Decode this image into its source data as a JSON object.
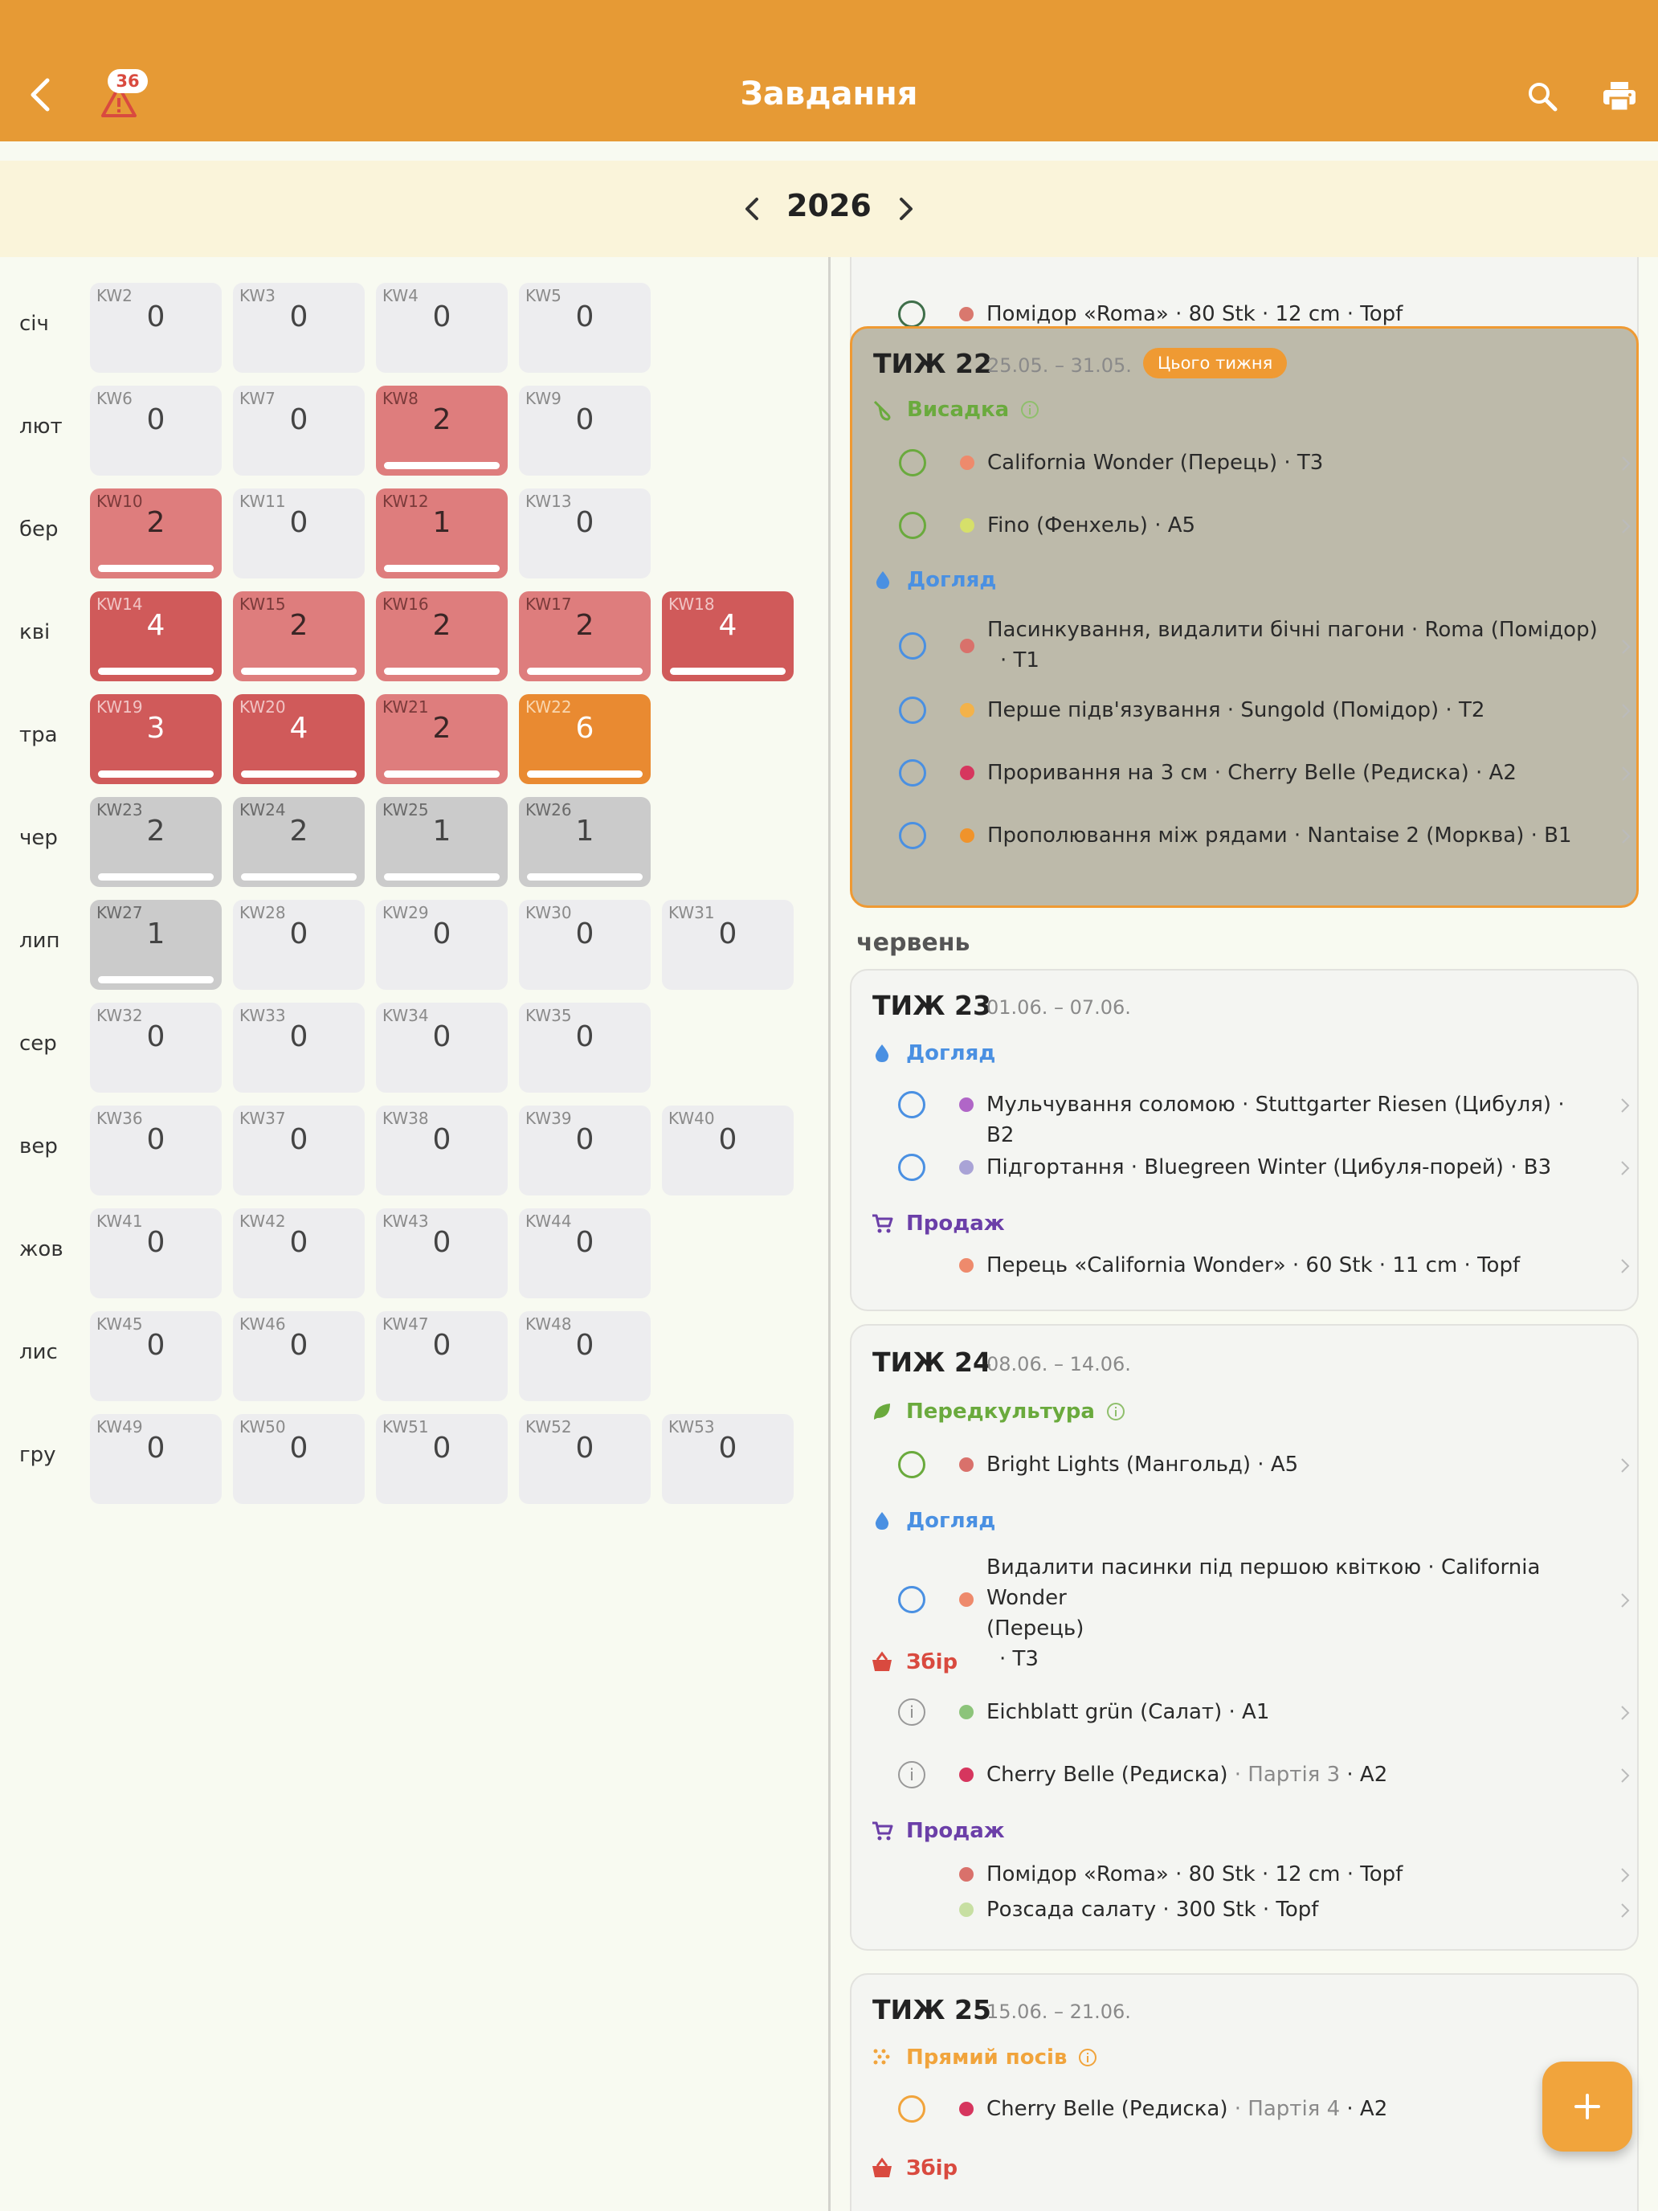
{
  "app": {
    "title": "Завдання",
    "alert_count": "36",
    "year": "2026"
  },
  "colors": {
    "accent": "#e69a35",
    "current_week": "#e98a31",
    "low": "#de7d7d",
    "high": "#d05a5a",
    "past": "#cbcbcb",
    "empty": "#ededef"
  },
  "icons": [
    "back-icon",
    "warning-icon",
    "search-icon",
    "print-icon",
    "chevron-left-icon",
    "chevron-right-icon",
    "plus-icon"
  ],
  "grid": {
    "months": [
      {
        "label": "січ",
        "weeks": [
          {
            "kw": "KW2",
            "count": "0",
            "level": "empty"
          },
          {
            "kw": "KW3",
            "count": "0",
            "level": "empty"
          },
          {
            "kw": "KW4",
            "count": "0",
            "level": "empty"
          },
          {
            "kw": "KW5",
            "count": "0",
            "level": "empty"
          }
        ]
      },
      {
        "label": "лют",
        "weeks": [
          {
            "kw": "KW6",
            "count": "0",
            "level": "empty"
          },
          {
            "kw": "KW7",
            "count": "0",
            "level": "empty"
          },
          {
            "kw": "KW8",
            "count": "2",
            "level": "r1"
          },
          {
            "kw": "KW9",
            "count": "0",
            "level": "empty"
          }
        ]
      },
      {
        "label": "бер",
        "weeks": [
          {
            "kw": "KW10",
            "count": "2",
            "level": "r1"
          },
          {
            "kw": "KW11",
            "count": "0",
            "level": "empty"
          },
          {
            "kw": "KW12",
            "count": "1",
            "level": "r1"
          },
          {
            "kw": "KW13",
            "count": "0",
            "level": "empty"
          }
        ]
      },
      {
        "label": "кві",
        "weeks": [
          {
            "kw": "KW14",
            "count": "4",
            "level": "r2"
          },
          {
            "kw": "KW15",
            "count": "2",
            "level": "r1"
          },
          {
            "kw": "KW16",
            "count": "2",
            "level": "r1"
          },
          {
            "kw": "KW17",
            "count": "2",
            "level": "r1"
          },
          {
            "kw": "KW18",
            "count": "4",
            "level": "r2"
          }
        ]
      },
      {
        "label": "тра",
        "weeks": [
          {
            "kw": "KW19",
            "count": "3",
            "level": "r2"
          },
          {
            "kw": "KW20",
            "count": "4",
            "level": "r2"
          },
          {
            "kw": "KW21",
            "count": "2",
            "level": "r1"
          },
          {
            "kw": "KW22",
            "count": "6",
            "level": "cur"
          }
        ]
      },
      {
        "label": "чер",
        "weeks": [
          {
            "kw": "KW23",
            "count": "2",
            "level": "gray"
          },
          {
            "kw": "KW24",
            "count": "2",
            "level": "gray"
          },
          {
            "kw": "KW25",
            "count": "1",
            "level": "gray"
          },
          {
            "kw": "KW26",
            "count": "1",
            "level": "gray"
          }
        ]
      },
      {
        "label": "лип",
        "weeks": [
          {
            "kw": "KW27",
            "count": "1",
            "level": "gray"
          },
          {
            "kw": "KW28",
            "count": "0",
            "level": "empty"
          },
          {
            "kw": "KW29",
            "count": "0",
            "level": "empty"
          },
          {
            "kw": "KW30",
            "count": "0",
            "level": "empty"
          },
          {
            "kw": "KW31",
            "count": "0",
            "level": "empty"
          }
        ]
      },
      {
        "label": "сер",
        "weeks": [
          {
            "kw": "KW32",
            "count": "0",
            "level": "empty"
          },
          {
            "kw": "KW33",
            "count": "0",
            "level": "empty"
          },
          {
            "kw": "KW34",
            "count": "0",
            "level": "empty"
          },
          {
            "kw": "KW35",
            "count": "0",
            "level": "empty"
          }
        ]
      },
      {
        "label": "вер",
        "weeks": [
          {
            "kw": "KW36",
            "count": "0",
            "level": "empty"
          },
          {
            "kw": "KW37",
            "count": "0",
            "level": "empty"
          },
          {
            "kw": "KW38",
            "count": "0",
            "level": "empty"
          },
          {
            "kw": "KW39",
            "count": "0",
            "level": "empty"
          },
          {
            "kw": "KW40",
            "count": "0",
            "level": "empty"
          }
        ]
      },
      {
        "label": "жов",
        "weeks": [
          {
            "kw": "KW41",
            "count": "0",
            "level": "empty"
          },
          {
            "kw": "KW42",
            "count": "0",
            "level": "empty"
          },
          {
            "kw": "KW43",
            "count": "0",
            "level": "empty"
          },
          {
            "kw": "KW44",
            "count": "0",
            "level": "empty"
          }
        ]
      },
      {
        "label": "лис",
        "weeks": [
          {
            "kw": "KW45",
            "count": "0",
            "level": "empty"
          },
          {
            "kw": "KW46",
            "count": "0",
            "level": "empty"
          },
          {
            "kw": "KW47",
            "count": "0",
            "level": "empty"
          },
          {
            "kw": "KW48",
            "count": "0",
            "level": "empty"
          }
        ]
      },
      {
        "label": "гру",
        "weeks": [
          {
            "kw": "KW49",
            "count": "0",
            "level": "empty"
          },
          {
            "kw": "KW50",
            "count": "0",
            "level": "empty"
          },
          {
            "kw": "KW51",
            "count": "0",
            "level": "empty"
          },
          {
            "kw": "KW52",
            "count": "0",
            "level": "empty"
          },
          {
            "kw": "KW53",
            "count": "0",
            "level": "empty"
          }
        ]
      }
    ]
  },
  "list": {
    "partial_top_text": "Помідор «Roma» · 80 Stk · 12 cm · Topf",
    "month_june": "червень",
    "w22": {
      "title": "ТИЖ 22",
      "dates": "25.05. – 31.05.",
      "badge": "Цього тижня",
      "cat1": "Висадка",
      "t1": "California Wonder (Перець)",
      "t1s": " · T3",
      "t2": "Fino (Фенхель)",
      "t2s": " · A5",
      "cat2": "Догляд",
      "t3a": "Пасинкування, видалити бічні пагони · Roma (Помідор)",
      "t3b": "· T1",
      "t4": "Перше підв'язування · Sungold (Помідор)",
      "t4s": " · T2",
      "t5": "Проривання на 3 см · Cherry Belle (Редиска)",
      "t5s": " · A2",
      "t6": "Прополювання між рядами · Nantaise 2 (Морква)",
      "t6s": " · B1"
    },
    "w23": {
      "title": "ТИЖ 23",
      "dates": "01.06. – 07.06.",
      "cat1": "Догляд",
      "t1": "Мульчування соломою · Stuttgarter Riesen (Цибуля)",
      "t1s": " · B2",
      "t2": "Підгортання · Bluegreen Winter (Цибуля-порей)",
      "t2s": " · B3",
      "cat2": "Продаж",
      "t3": "Перець «California Wonder» · 60 Stk · 11 cm",
      "t3s": " · Topf"
    },
    "w24": {
      "title": "ТИЖ 24",
      "dates": "08.06. – 14.06.",
      "cat1": "Передкультура",
      "t1": "Bright Lights (Мангольд)",
      "t1s": " · A5",
      "cat2": "Догляд",
      "t2a": "Видалити пасинки під першою квіткою · California Wonder",
      "t2b": "(Перець)",
      "t2c": "· T3",
      "cat3": "Збір",
      "t3": "Eichblatt grün (Салат)",
      "t3s": " · A1",
      "t4": "Cherry Belle (Редиска)",
      "t4p": " · Партія 3",
      "t4s": " · A2",
      "cat4": "Продаж",
      "t5": "Помідор «Roma» · 80 Stk · 12 cm",
      "t5s": " · Topf",
      "t6": "Розсада салату · 300 Stk",
      "t6s": " · Topf"
    },
    "w25": {
      "title": "ТИЖ 25",
      "dates": "15.06. – 21.06.",
      "cat1": "Прямий посів",
      "t1": "Cherry Belle (Редиска)",
      "t1p": " · Партія 4",
      "t1s": " · A2",
      "cat2": "Збір"
    }
  }
}
